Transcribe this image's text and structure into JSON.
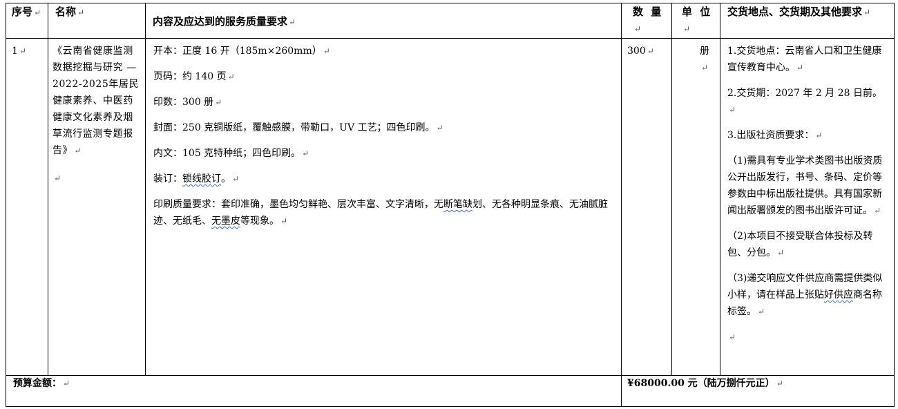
{
  "headers": {
    "index": "序号",
    "name": "名称",
    "content": "内容及应达到的服务质量要求",
    "quantity": "数 量",
    "unit": "单 位",
    "delivery": "交货地点、交货期及其他要求"
  },
  "row": {
    "index": "1",
    "name": "《云南省健康监测数据挖掘与研究 — 2022-2025年居民健康素养、中医药健康文化素养及烟草流行监测专题报告》",
    "content": [
      "开本：正度 16 开（185m×260mm）",
      "页码：约 140 页",
      "印数：300 册",
      "封面：250 克铜版纸，覆触感膜，带勒口，UV 工艺；四色印刷。",
      "内文：105 克特种纸；四色印刷。"
    ],
    "binding_label": "装订：",
    "binding_value": "锁线胶订",
    "binding_end": "。",
    "quality_part1": "印刷质量要求：套印准确，墨色均匀鲜艳、层次丰富、文字清晰，无",
    "quality_wavy1": "断笔缺",
    "quality_part2": "划、无各种明显条痕、无油腻脏迹、无纸毛、",
    "quality_wavy2": "无墨皮",
    "quality_part3": "等现象。",
    "quantity": "300",
    "unit": "册",
    "delivery": [
      "1.交货地点：云南省人口和卫生健康宣传教育中心。",
      "2.交货期：2027 年 2 月 28 日前。",
      "3.出版社资质要求：",
      "（1)需具有专业学术类图书出版资质公开出版发行，书号、条码、定价等参数由中标出版社提供。具有国家新闻出版署颁发的图书出版许可证。",
      "（2)本项目不接受联合体投标及转包、分包。"
    ],
    "delivery_last_part1": "（3)递交响应文件供应商需提供类似小样，请在样品上张贴",
    "delivery_last_wavy": "好供应",
    "delivery_last_part2": "商名称标签。"
  },
  "footer": {
    "budget_label": "预算金额：",
    "budget_value": "¥68000.00 元（陆万捌仟元正）"
  },
  "marks": {
    "return": "↵",
    "cell_end": "↵"
  }
}
